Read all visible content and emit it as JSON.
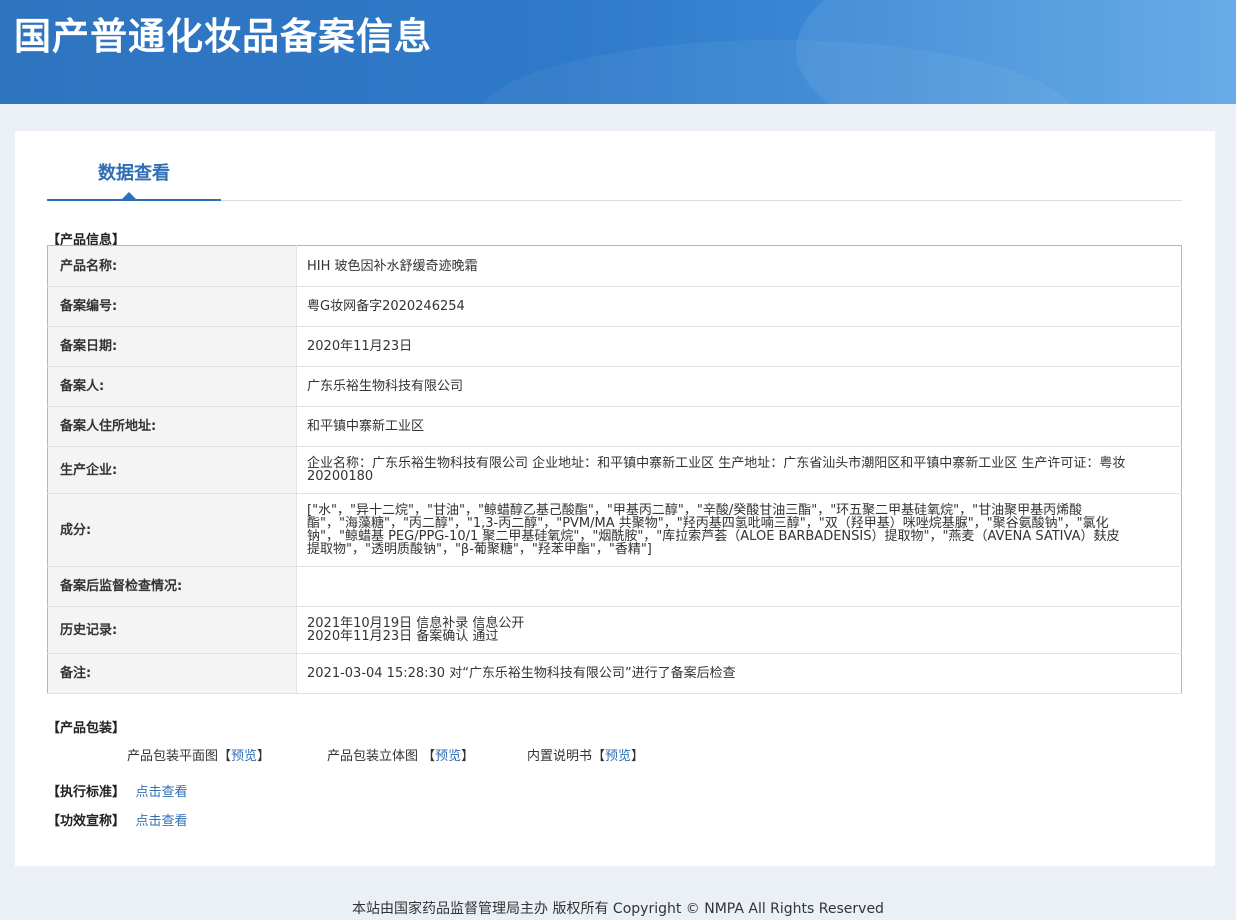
{
  "header": {
    "title": "国产普通化妆品备案信息"
  },
  "tabs": [
    {
      "label": "数据查看"
    }
  ],
  "product_info": {
    "section_title": "【产品信息】",
    "rows": [
      {
        "label": "产品名称:",
        "value": "HIH 玻色因补水舒缓奇迹晚霜"
      },
      {
        "label": "备案编号:",
        "value": "粤G妆网备字2020246254"
      },
      {
        "label": "备案日期:",
        "value": "2020年11月23日"
      },
      {
        "label": "备案人:",
        "value": "广东乐裕生物科技有限公司"
      },
      {
        "label": "备案人住所地址:",
        "value": "和平镇中寨新工业区"
      },
      {
        "label": "生产企业:",
        "value": "企业名称：广东乐裕生物科技有限公司 企业地址：和平镇中寨新工业区 生产地址：广东省汕头市潮阳区和平镇中寨新工业区 生产许可证：粤妆20200180"
      },
      {
        "label": "成分:",
        "value": "[\"水\"，\"异十二烷\"，\"甘油\"，\"鲸蜡醇乙基己酸酯\"，\"甲基丙二醇\"，\"辛酸/癸酸甘油三酯\"，\"环五聚二甲基硅氧烷\"，\"甘油聚甲基丙烯酸酯\"，\"海藻糖\"，\"丙二醇\"，\"1,3-丙二醇\"，\"PVM/MA 共聚物\"，\"羟丙基四氢吡喃三醇\"，\"双（羟甲基）咪唑烷基脲\"，\"聚谷氨酸钠\"，\"氯化钠\"，\"鲸蜡基 PEG/PPG-10/1 聚二甲基硅氧烷\"，\"烟酰胺\"，\"库拉索芦荟（ALOE BARBADENSIS）提取物\"，\"燕麦（AVENA SATIVA）麸皮提取物\"，\"透明质酸钠\"，\"β-葡聚糖\"，\"羟苯甲酯\"，\"香精\"]"
      },
      {
        "label": "备案后监督检查情况:",
        "value": ""
      },
      {
        "label": "历史记录:",
        "value": "2021年10月19日 信息补录 信息公开\n2020年11月23日 备案确认 通过"
      },
      {
        "label": "备注:",
        "value": "2021-03-04 15:28:30 对“广东乐裕生物科技有限公司”进行了备案后检查"
      }
    ]
  },
  "packaging": {
    "section_title": "【产品包装】",
    "items": [
      {
        "name": "产品包装平面图",
        "link": "预览"
      },
      {
        "name": "产品包装立体图",
        "link": "预览"
      },
      {
        "name": "内置说明书",
        "link": "预览"
      }
    ]
  },
  "standard": {
    "section_title": "【执行标准】",
    "link": "点击查看"
  },
  "efficacy": {
    "section_title": "【功效宣称】",
    "link": "点击查看"
  },
  "footer": {
    "text": "本站由国家药品监督管理局主办 版权所有 Copyright © NMPA All Rights Reserved"
  }
}
